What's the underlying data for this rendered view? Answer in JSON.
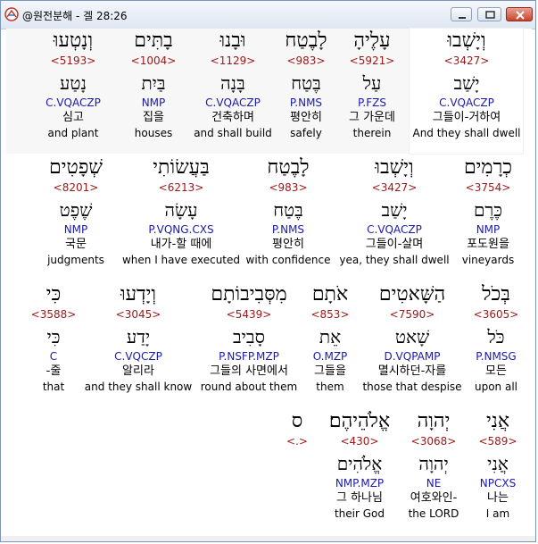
{
  "window": {
    "title": "@원전분해 - 겔 28:26",
    "controls": {
      "minimize": "minimize",
      "maximize": "maximize",
      "close": "close"
    }
  },
  "rows": [
    {
      "words": [
        {
          "heb": "וְנָטְעוּ",
          "strong": "<5193>",
          "lemma": "נָטַע",
          "parse": "C.VQACZP",
          "kor": "심고",
          "eng": "and plant"
        },
        {
          "heb": "בָתִּים",
          "strong": "<1004>",
          "lemma": "בַּיִת",
          "parse": "NMP",
          "kor": "집을",
          "eng": "houses"
        },
        {
          "heb": "וּבָנוּ",
          "strong": "<1129>",
          "lemma": "בָּנָה",
          "parse": "C.VQACZP",
          "kor": "건축하며",
          "eng": "and shall build"
        },
        {
          "heb": "לָבֶטַח",
          "strong": "<983>",
          "lemma": "בֶּטַח",
          "parse": "P.NMS",
          "kor": "평안히",
          "eng": "safely"
        },
        {
          "heb": "עָלֶיהָ",
          "strong": "<5921>",
          "lemma": "עַל",
          "parse": "P.FZS",
          "kor": "그 가운데",
          "eng": "therein"
        },
        {
          "heb": "וְיָשְׁבוּ",
          "strong": "<3427>",
          "lemma": "יָשַׁב",
          "parse": "C.VQACZP",
          "kor": "그들이-거하여",
          "eng": "And they shall dwell"
        }
      ]
    },
    {
      "words": [
        {
          "heb": "שְׁפָטִים",
          "strong": "<8201>",
          "lemma": "שֶׁפֶט",
          "parse": "NMP",
          "kor": "국문",
          "eng": "judgments"
        },
        {
          "heb": "בַּעֲשׂוֹתִי",
          "strong": "<6213>",
          "lemma": "עָשָׂה",
          "parse": "P.VQNG.CXS",
          "kor": "내가-할 때에",
          "eng": "when I have executed"
        },
        {
          "heb": "לָבֶטַח",
          "strong": "<983>",
          "lemma": "בֶּטַח",
          "parse": "P.NMS",
          "kor": "평안히",
          "eng": "with confidence"
        },
        {
          "heb": "וְיָשְׁבוּ",
          "strong": "<3427>",
          "lemma": "יָשַׁב",
          "parse": "C.VQACZP",
          "kor": "그들이-살며",
          "eng": "yea, they shall dwell"
        },
        {
          "heb": "כְרָמִים",
          "strong": "<3754>",
          "lemma": "כֶּרֶם",
          "parse": "NMP",
          "kor": "포도원을",
          "eng": "vineyards"
        }
      ]
    },
    {
      "words": [
        {
          "heb": "כִּי",
          "strong": "<3588>",
          "lemma": "כִּי",
          "parse": "C",
          "kor": "-줄",
          "eng": "that"
        },
        {
          "heb": "וְיָדְעוּ",
          "strong": "<3045>",
          "lemma": "יָדַע",
          "parse": "C.VQCZP",
          "kor": "알리라",
          "eng": "and they shall know"
        },
        {
          "heb": "מִסְּבִיבוֹתָם",
          "strong": "<5439>",
          "lemma": "סָבִיב",
          "parse": "P.NSFP.MZP",
          "kor": "그들의 사면에서",
          "eng": "round about them"
        },
        {
          "heb": "אֹתָם",
          "strong": "<853>",
          "lemma": "אֵת",
          "parse": "O.MZP",
          "kor": "그들을",
          "eng": "them"
        },
        {
          "heb": "הַשָּׁאטִים",
          "strong": "<7590>",
          "lemma": "שָׁאט",
          "parse": "D.VQPAMP",
          "kor": "멸시하던-자를",
          "eng": "those that despise"
        },
        {
          "heb": "בְּכֹל",
          "strong": "<3605>",
          "lemma": "כֹּל",
          "parse": "P.NMSG",
          "kor": "모든",
          "eng": "upon all"
        }
      ]
    },
    {
      "words": [
        {
          "heb": "ס",
          "strong": "<.>",
          "lemma": "",
          "parse": "",
          "kor": "",
          "eng": ""
        },
        {
          "heb": "אֱלֹהֵיהֶם׃",
          "strong": "<430>",
          "lemma": "אֱלֹהִים",
          "parse": "NMP.MZP",
          "kor": "그 하나님",
          "eng": "their God"
        },
        {
          "heb": "יְהוָה",
          "strong": "<3068>",
          "lemma": "יְהוָה",
          "parse": "NE",
          "kor": "여호와인-",
          "eng": "the LORD"
        },
        {
          "heb": "אֲנִי",
          "strong": "<589>",
          "lemma": "אֲנִי",
          "parse": "NPCXS",
          "kor": "나는",
          "eng": "I am"
        }
      ]
    }
  ]
}
